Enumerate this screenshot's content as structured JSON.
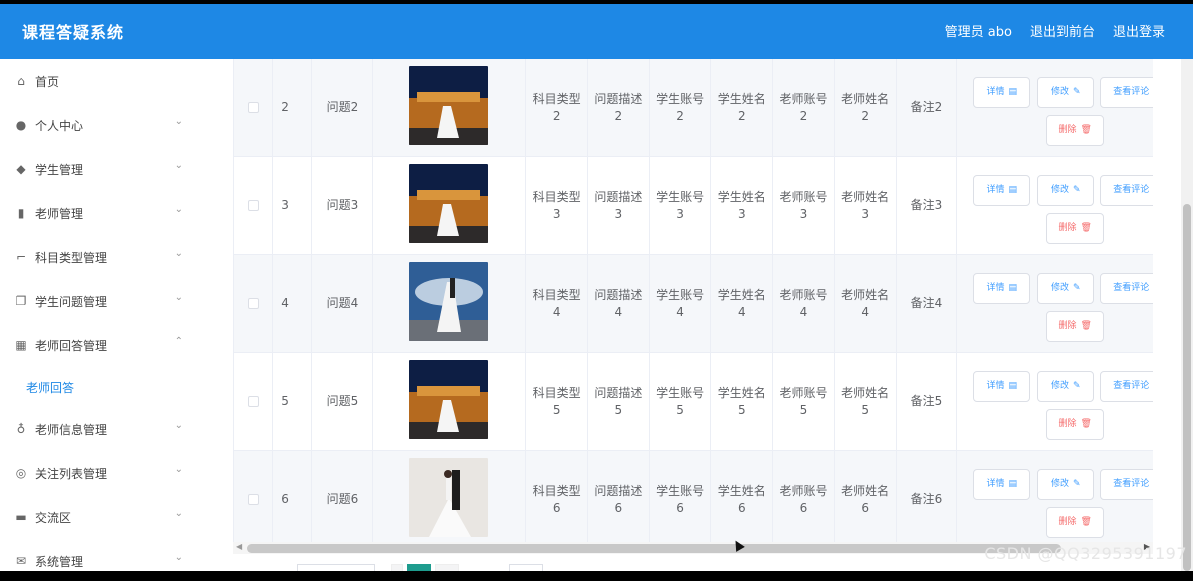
{
  "header": {
    "title": "课程答疑系统",
    "admin_label": "管理员 abo",
    "back_front": "退出到前台",
    "logout": "退出登录"
  },
  "sidebar": {
    "items": [
      {
        "label": "首页",
        "icon": "home-icon",
        "chevron": ""
      },
      {
        "label": "个人中心",
        "icon": "user-icon",
        "chevron": "⌄"
      },
      {
        "label": "学生管理",
        "icon": "location-icon",
        "chevron": "⌄"
      },
      {
        "label": "老师管理",
        "icon": "bar-chart-icon",
        "chevron": "⌄"
      },
      {
        "label": "科目类型管理",
        "icon": "crop-icon",
        "chevron": "⌄"
      },
      {
        "label": "学生问题管理",
        "icon": "copy-icon",
        "chevron": "⌄"
      },
      {
        "label": "老师回答管理",
        "icon": "grid-icon",
        "chevron": "⌃"
      },
      {
        "label": "老师信息管理",
        "icon": "mic-icon",
        "chevron": "⌄"
      },
      {
        "label": "关注列表管理",
        "icon": "target-icon",
        "chevron": "⌄"
      },
      {
        "label": "交流区",
        "icon": "briefcase-icon",
        "chevron": "⌄"
      },
      {
        "label": "系统管理",
        "icon": "mail-icon",
        "chevron": "⌄"
      }
    ],
    "subitem": "老师回答"
  },
  "table": {
    "rows": [
      {
        "id": "2",
        "question": "问题2",
        "photo": "night",
        "subject": [
          "科目类型",
          "2"
        ],
        "desc": [
          "问题描述",
          "2"
        ],
        "sacc": [
          "学生账号",
          "2"
        ],
        "sname": [
          "学生姓名",
          "2"
        ],
        "tacc": [
          "老师账号",
          "2"
        ],
        "tname": [
          "老师姓名",
          "2"
        ],
        "note": "备注2"
      },
      {
        "id": "3",
        "question": "问题3",
        "photo": "night",
        "subject": [
          "科目类型",
          "3"
        ],
        "desc": [
          "问题描述",
          "3"
        ],
        "sacc": [
          "学生账号",
          "3"
        ],
        "sname": [
          "学生姓名",
          "3"
        ],
        "tacc": [
          "老师账号",
          "3"
        ],
        "tname": [
          "老师姓名",
          "3"
        ],
        "note": "备注3"
      },
      {
        "id": "4",
        "question": "问题4",
        "photo": "sky",
        "subject": [
          "科目类型",
          "4"
        ],
        "desc": [
          "问题描述",
          "4"
        ],
        "sacc": [
          "学生账号",
          "4"
        ],
        "sname": [
          "学生姓名",
          "4"
        ],
        "tacc": [
          "老师账号",
          "4"
        ],
        "tname": [
          "老师姓名",
          "4"
        ],
        "note": "备注4"
      },
      {
        "id": "5",
        "question": "问题5",
        "photo": "night",
        "subject": [
          "科目类型",
          "5"
        ],
        "desc": [
          "问题描述",
          "5"
        ],
        "sacc": [
          "学生账号",
          "5"
        ],
        "sname": [
          "学生姓名",
          "5"
        ],
        "tacc": [
          "老师账号",
          "5"
        ],
        "tname": [
          "老师姓名",
          "5"
        ],
        "note": "备注5"
      },
      {
        "id": "6",
        "question": "问题6",
        "photo": "studio",
        "subject": [
          "科目类型",
          "6"
        ],
        "desc": [
          "问题描述",
          "6"
        ],
        "sacc": [
          "学生账号",
          "6"
        ],
        "sname": [
          "学生姓名",
          "6"
        ],
        "tacc": [
          "老师账号",
          "6"
        ],
        "tname": [
          "老师姓名",
          "6"
        ],
        "note": "备注6"
      }
    ],
    "buttons": {
      "detail": "详情",
      "edit": "修改",
      "view": "查看评论",
      "delete": "删除"
    }
  },
  "colors": {
    "primary": "#1e88e5",
    "danger": "#f56c6c",
    "pager_active": "#1e9c8e"
  },
  "watermark": "CSDN @QQ3295391197"
}
